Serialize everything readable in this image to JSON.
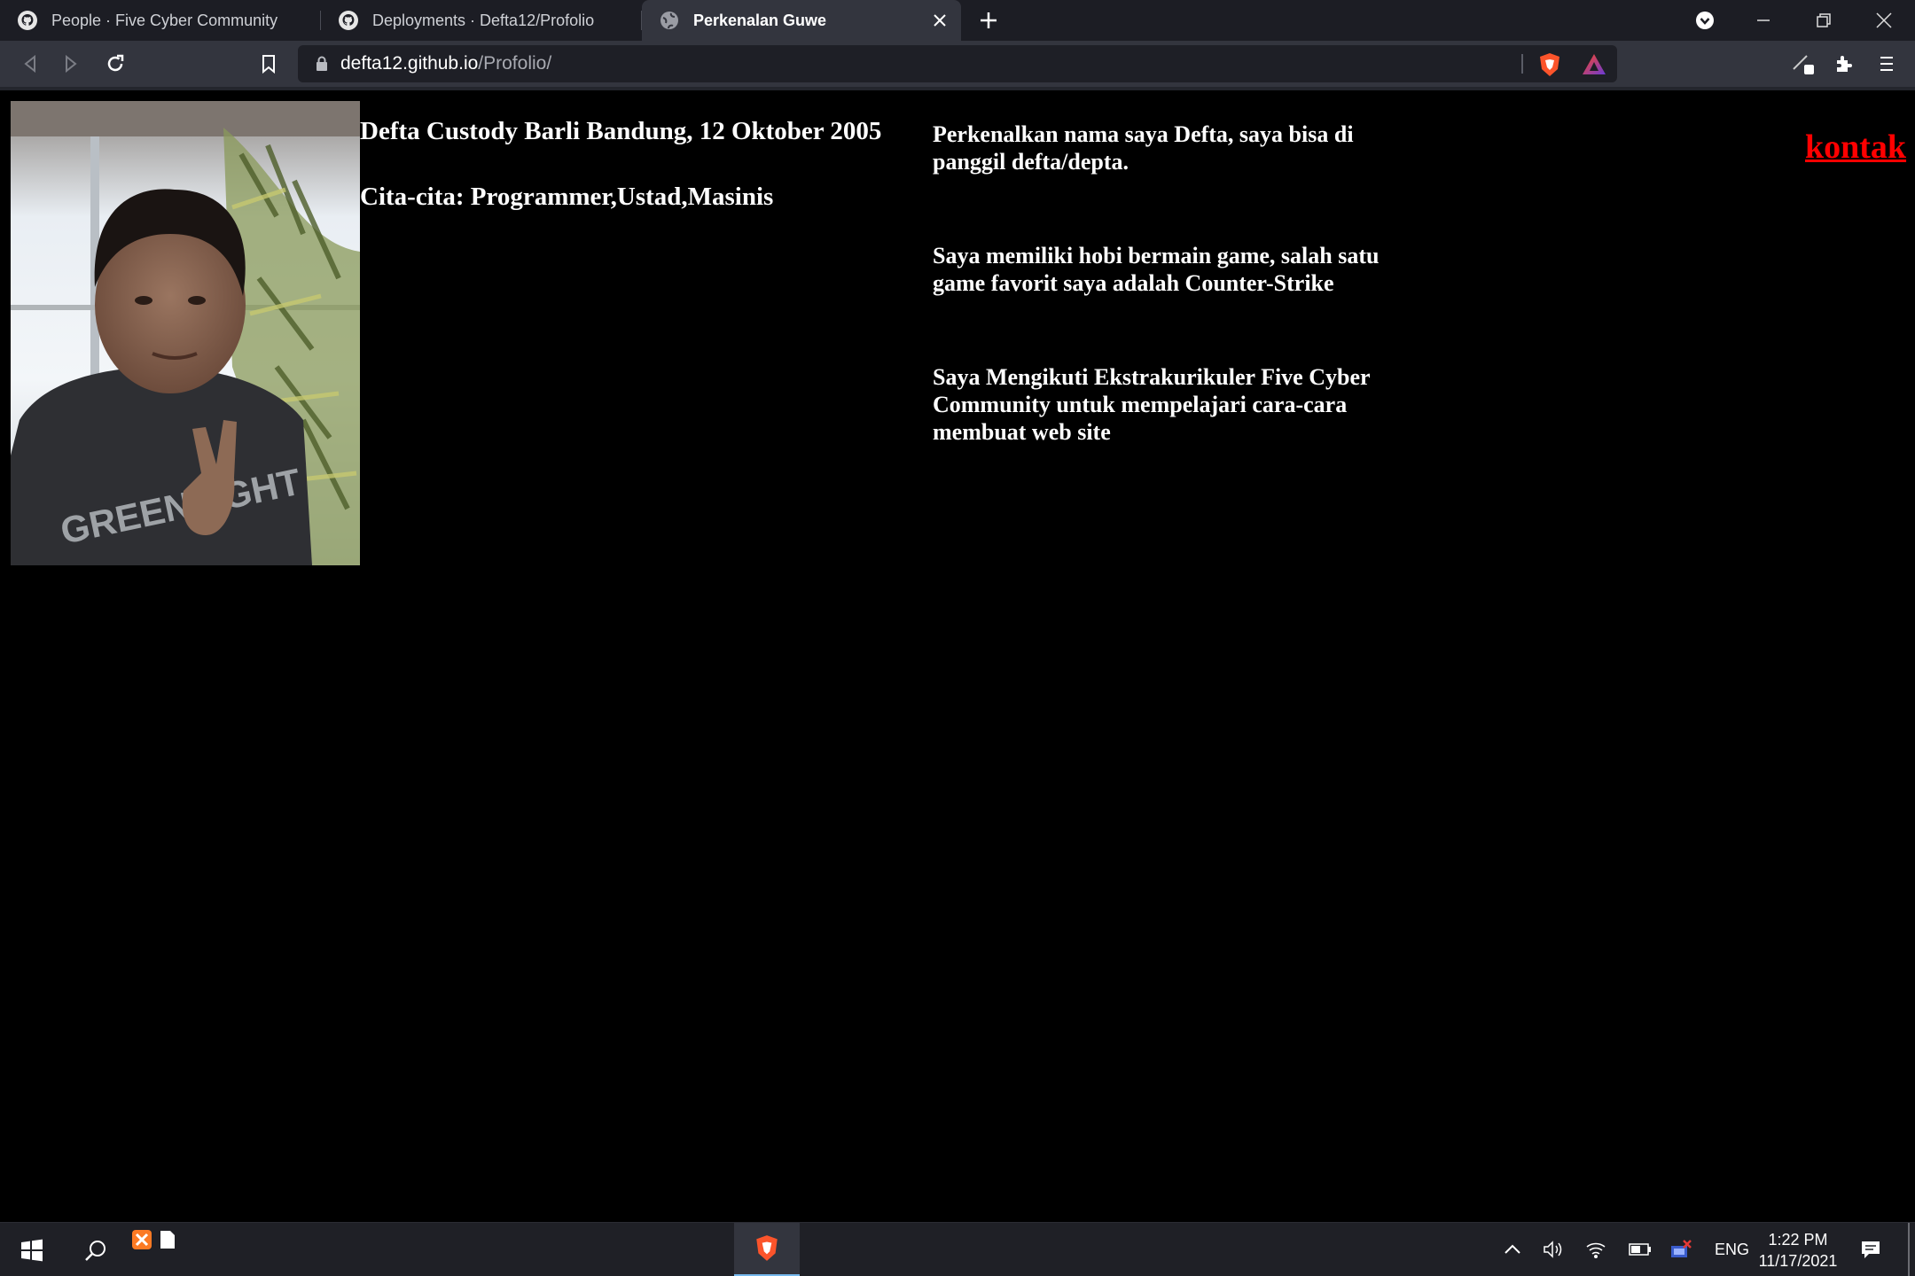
{
  "browser": {
    "tabs": [
      {
        "title": "People · Five Cyber Community",
        "icon": "github-icon",
        "active": false
      },
      {
        "title": "Deployments · Defta12/Profolio",
        "icon": "github-icon",
        "active": false
      },
      {
        "title": "Perkenalan Guwe",
        "icon": "globe-icon",
        "active": true
      }
    ],
    "url_host": "defta12.github.io",
    "url_path": "/Profolio/"
  },
  "page": {
    "photo_alt": "",
    "bio_name": "Defta Custody Barli Bandung, 12 Oktober 2005",
    "bio_goal": "Cita-cita: Programmer,Ustad,Masinis",
    "paragraphs": [
      "Perkenalkan nama saya Defta, saya bisa di panggil defta/depta.",
      "Saya memiliki hobi bermain game, salah satu game favorit saya adalah Counter-Strike",
      "Saya Mengikuti Ekstrakurikuler Five Cyber Community untuk mempelajari cara-cara membuat web site"
    ],
    "contact_link": "kontak"
  },
  "taskbar": {
    "language": "ENG",
    "time": "1:22 PM",
    "date": "11/17/2021"
  },
  "colors": {
    "link": "#ff0000",
    "page_bg": "#000000",
    "chrome_bg": "#33353e",
    "tabstrip_bg": "#1c1d24",
    "brave_orange": "#fb542b"
  }
}
